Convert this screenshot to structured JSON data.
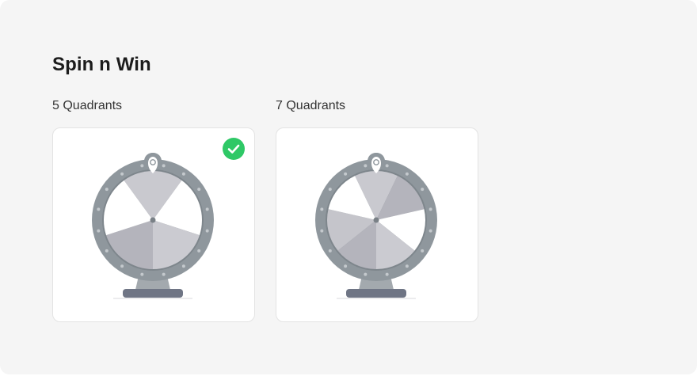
{
  "page": {
    "title": "Spin n Win"
  },
  "options": [
    {
      "label": "5 Quadrants",
      "segments": 5,
      "selected": true,
      "segment_colors": [
        "#c9c9cf",
        "#ffffff",
        "#cbcbd1",
        "#b4b4bc",
        "#ffffff"
      ]
    },
    {
      "label": "7 Quadrants",
      "segments": 7,
      "selected": false,
      "segment_colors": [
        "#c9c9cf",
        "#b4b4bc",
        "#ffffff",
        "#cbcbd1",
        "#b4b4bc",
        "#c5c5cb",
        "#ffffff"
      ]
    }
  ],
  "colors": {
    "selected_check": "#2ec866",
    "wheel_rim": "#8f979d",
    "wheel_stand": "#a3a9ae",
    "wheel_base": "#6f7585"
  },
  "icons": {
    "selected": "checkmark-circle-icon",
    "pointer": "map-pin-icon"
  }
}
